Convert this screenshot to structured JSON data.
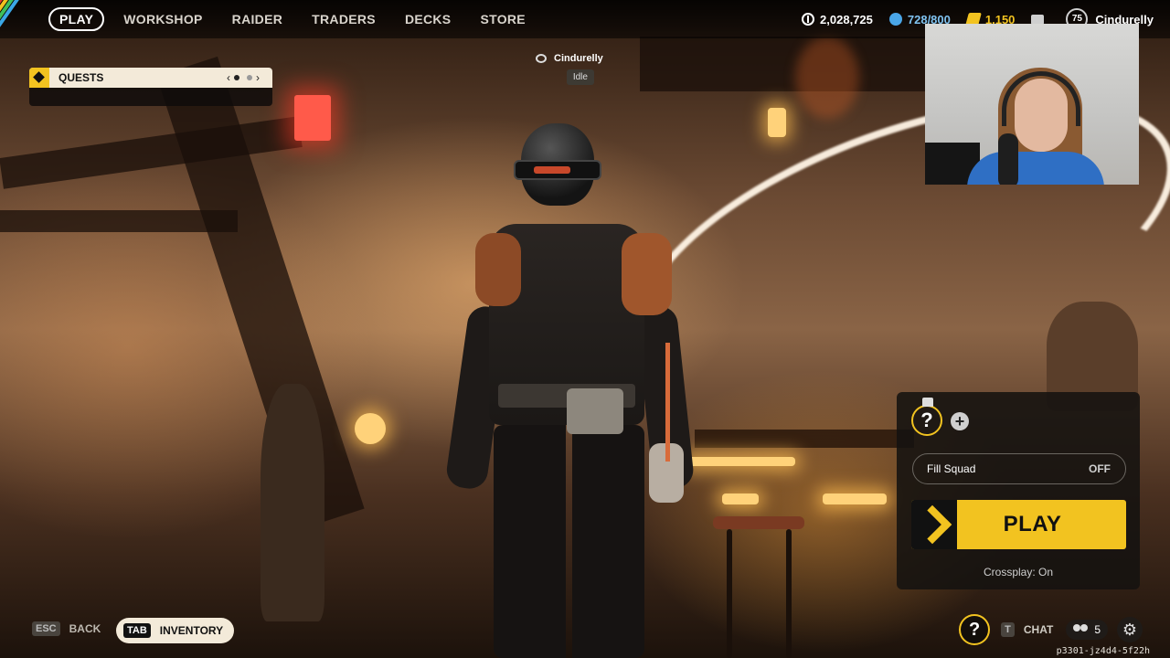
{
  "nav": {
    "items": [
      {
        "label": "PLAY",
        "active": true
      },
      {
        "label": "WORKSHOP",
        "active": false
      },
      {
        "label": "RAIDER",
        "active": false
      },
      {
        "label": "TRADERS",
        "active": false
      },
      {
        "label": "DECKS",
        "active": false
      },
      {
        "label": "STORE",
        "active": false
      }
    ]
  },
  "currencies": {
    "coins": "2,028,725",
    "tokens": "728/800",
    "credits": "1,150"
  },
  "profile": {
    "level": "75",
    "username": "Cindurelly"
  },
  "quests": {
    "title": "QUESTS",
    "prev": "‹",
    "next": "›"
  },
  "player_tag": {
    "name": "Cindurelly",
    "status": "Idle"
  },
  "squad": {
    "empty_slot": "?",
    "add": "+",
    "fill_squad_label": "Fill Squad",
    "fill_squad_value": "OFF",
    "play_label": "PLAY",
    "crossplay": "Crossplay: On"
  },
  "hints": {
    "back_key": "ESC",
    "back_label": "BACK",
    "inventory_key": "TAB",
    "inventory_label": "INVENTORY",
    "chat_key": "T",
    "chat_label": "CHAT",
    "friends_count": "5",
    "party_slot": "?"
  },
  "build_id": "p3301-jz4d4-5f22h",
  "colors": {
    "accent": "#f2c320",
    "panel_light": "#f3ead9",
    "token_blue": "#4aa6e8"
  },
  "icons": {
    "coins": "coin-icon",
    "tokens": "token-icon",
    "credits": "credit-icon",
    "mail": "mail-icon",
    "settings": "gear-icon",
    "friends": "people-icon",
    "leader": "crown-icon"
  }
}
